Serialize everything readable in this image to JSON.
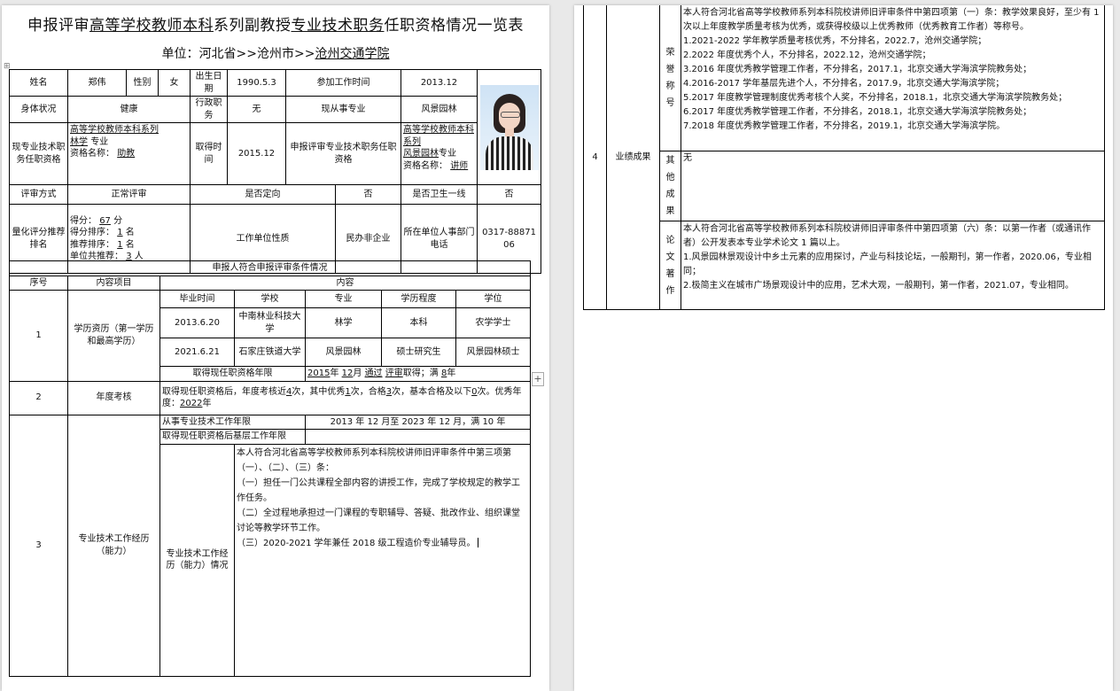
{
  "title": {
    "pre": "申报评审",
    "u1": "高等学校教师本科",
    "mid": "系列副教授",
    "u2": "专业技术职务",
    "post": "任职资格情况一览表"
  },
  "unit": {
    "label": "单位：",
    "province": "河北省",
    "sep1": ">>",
    "city": "沧州市",
    ">>": "",
    "sep2": ">>",
    "org": "沧州交通学院"
  },
  "basic": {
    "name_label": "姓名",
    "name": "郑伟",
    "gender_label": "性别",
    "gender": "女",
    "birth_label": "出生日期",
    "birth": "1990.5.3",
    "work_label": "参加工作时间",
    "work": "2013.12",
    "health_label": "身体状况",
    "health": "健康",
    "admin_label": "行政职务",
    "admin": "无",
    "major_label": "现从事专业",
    "major": "风景园林",
    "cur_title_label": "现专业技术职务任职资格",
    "cur_series": "高等学校教师本科系列",
    "cur_major": "林学",
    "cur_major_suffix": "专业",
    "cur_qual_label": "资格名称：",
    "cur_qual": "助教",
    "get_time_label": "取得时间",
    "get_time": "2015.12",
    "apply_label": "申报评审专业技术职务任职资格",
    "apply_series": "高等学校教师本科系列",
    "apply_major": "风景园林",
    "apply_major_suffix": "专业",
    "apply_qual_label": "资格名称：",
    "apply_qual": "讲师",
    "review_label": "评审方式",
    "review": "正常评审",
    "direct_label": "是否定向",
    "direct": "否",
    "health_line_label": "是否卫生一线",
    "health_line": "否",
    "score_label": "量化评分推荐排名",
    "score_pre": "得分：",
    "score": "67",
    "score_unit": "分",
    "rank_pre": "得分排序：",
    "rank": "1",
    "rank_unit": "名",
    "rec_pre": "推荐排序：",
    "rec": "1",
    "rec_unit": "名",
    "total_pre": "单位共推荐：",
    "total": "3",
    "total_unit": "人",
    "org_type_label": "工作单位性质",
    "org_type": "民办非企业",
    "phone_label": "所在单位人事部门电话",
    "phone": "0317-8887106"
  },
  "conditions": {
    "section_title": "申报人符合申报评审条件情况",
    "h_no": "序号",
    "h_item": "内容项目",
    "h_content": "内容",
    "edu": {
      "no": "1",
      "item": "学历资历（第一学历和最高学历）",
      "cols": [
        "毕业时间",
        "学校",
        "专业",
        "学历程度",
        "学位"
      ],
      "rows": [
        [
          "2013.6.20",
          "中南林业科技大学",
          "林学",
          "本科",
          "农学学士"
        ],
        [
          "2021.6.21",
          "石家庄铁道大学",
          "风景园林",
          "硕士研究生",
          "风景园林硕士"
        ]
      ],
      "years_label": "取得现任职资格年限",
      "years_y": "2015",
      "years_y_u": "年",
      "years_m": "12",
      "years_m_u": "月",
      "years_via": "通过",
      "years_method": "评审",
      "years_get": "取得；满",
      "years_n": "8",
      "years_n_u": "年"
    },
    "annual": {
      "no": "2",
      "item": "年度考核",
      "t1": "取得现任职资格后，年度考核近",
      "n1": "4",
      "t2": "次，其中优秀",
      "n2": "1",
      "t3": "次，合格",
      "n3": "3",
      "t4": "次，基本合格及以下",
      "n4": "0",
      "t5": "次。优秀年度：",
      "n5": "2022",
      "t6": "年"
    },
    "work": {
      "no": "3",
      "item": "专业技术工作经历（能力）",
      "years_label": "从事专业技术工作年限",
      "years_value": "2013 年 12 月至 2023 年 12 月，满 10 年",
      "grassroots_label": "取得现任职资格后基层工作年限",
      "grassroots_value": "",
      "detail_label": "专业技术工作经历（能力）情况",
      "detail_lines": [
        "本人符合河北省高等学校教师系列本科院校讲师旧评审条件中第三项第（一）、（二）、（三）条：",
        "（一）担任一门公共课程全部内容的讲授工作，完成了学校规定的教学工作任务。",
        "（二）全过程地承担过一门课程的专职辅导、答疑、批改作业、组织课堂讨论等教学环节工作。",
        "（三）2020-2021 学年兼任 2018 级工程造价专业辅导员。"
      ]
    }
  },
  "achievements": {
    "no": "4",
    "item": "业绩成果",
    "honor_label": "荣誉称号",
    "honor_lines": [
      "本人符合河北省高等学校教师系列本科院校讲师旧评审条件中第四项第（一）条：教学效果良好，至少有 1 次以上年度教学质量考核为优秀，或获得校级以上优秀教师（优秀教育工作者）等称号。",
      "1.2021-2022 学年教学质量考核优秀，不分排名，2022.7，沧州交通学院；",
      "2.2022 年度优秀个人，不分排名，2022.12，沧州交通学院；",
      "3.2016 年度优秀教学管理工作者，不分排名，2017.1，北京交通大学海滨学院教务处；",
      "4.2016-2017 学年基层先进个人，不分排名，2017.9，北京交通大学海滨学院；",
      "5.2017 年度教学管理制度优秀考核个人奖，不分排名，2018.1，北京交通大学海滨学院教务处；",
      "6.2017 年度优秀教学管理工作者，不分排名，2018.1，北京交通大学海滨学院教务处；",
      "7.2018 年度优秀教学管理工作者，不分排名，2019.1，北京交通大学海滨学院。"
    ],
    "other_label": "其他成果",
    "other_value": "无",
    "paper_label": "论文著作",
    "paper_lines": [
      "本人符合河北省高等学校教师系列本科院校讲师旧评审条件中第四项第（六）条：以第一作者（或通讯作者）公开发表本专业学术论文 1 篇以上。",
      "1.风景园林景观设计中乡土元素的应用探讨，产业与科技论坛，一般期刊，第一作者，2020.06，专业相同；",
      "2.极简主义在城市广场景观设计中的应用，艺术大观，一般期刊，第一作者，2021.07，专业相同。"
    ]
  },
  "ui": {
    "corner_mark": "⊞",
    "add_button": "+"
  },
  "colors": {
    "page": "#ffffff",
    "background": "#e9e9e9",
    "border": "#000000"
  }
}
